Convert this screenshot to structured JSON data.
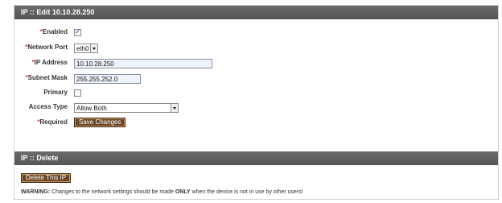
{
  "edit_section": {
    "title": "IP :: Edit 10.10.28.250"
  },
  "form": {
    "enabled": {
      "label": "Enabled",
      "required_mark": "*",
      "checked": true
    },
    "network_port": {
      "label": "Network Port",
      "required_mark": "*",
      "value": "eth0"
    },
    "ip_address": {
      "label": "IP Address",
      "required_mark": "*",
      "value": "10.10.28.250"
    },
    "subnet_mask": {
      "label": "Subnet Mask",
      "required_mark": "*",
      "value": "255.255.252.0"
    },
    "primary": {
      "label": "Primary",
      "checked": false
    },
    "access_type": {
      "label": "Access Type",
      "value": "Allow Both"
    },
    "required_note": {
      "mark": "*",
      "label": "Required"
    },
    "save_button": "Save Changes"
  },
  "delete_section": {
    "title": "IP :: Delete",
    "delete_button": "Delete This IP",
    "warning_label": "WARNING:",
    "warning_text_1": " Changes to the network settings should be made ",
    "warning_emphasis": "ONLY",
    "warning_text_2": " when the device is not in use by other users!"
  },
  "colors": {
    "header_bg": "#5f5f5f",
    "required_mark": "#d9462c",
    "button_bg": "#6a4626",
    "input_bg": "#eef3fb"
  },
  "icons": {
    "checkbox_checked": "check-icon",
    "dropdown": "chevron-down-icon"
  }
}
